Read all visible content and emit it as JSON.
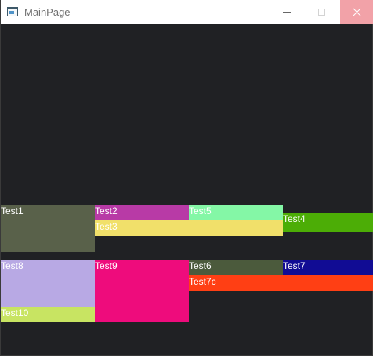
{
  "window": {
    "title": "MainPage",
    "controls": {
      "minimize": "minimize",
      "maximize": "maximize",
      "close": "close"
    }
  },
  "tiles": [
    {
      "id": "t1",
      "label": "Test1",
      "color": "#59614a"
    },
    {
      "id": "t2",
      "label": "Test2",
      "color": "#b83aa6"
    },
    {
      "id": "t3",
      "label": "Test3",
      "color": "#f1e06a"
    },
    {
      "id": "t4",
      "label": "Test4",
      "color": "#4cad06"
    },
    {
      "id": "t5",
      "label": "Test5",
      "color": "#84f7a6"
    },
    {
      "id": "t6",
      "label": "Test6",
      "color": "#4b5a3c"
    },
    {
      "id": "t7",
      "label": "Test7",
      "color": "#110c94"
    },
    {
      "id": "t7c",
      "label": "Test7c",
      "color": "#ff3f14"
    },
    {
      "id": "t8",
      "label": "Test8",
      "color": "#b8a9e4"
    },
    {
      "id": "t9",
      "label": "Test9",
      "color": "#ee0c7c"
    },
    {
      "id": "t10",
      "label": "Test10",
      "color": "#c8e462"
    }
  ],
  "colors": {
    "background": "#202124",
    "titlebar": "#ffffff",
    "close_hover": "#f2a2a8",
    "tile_text": "#ffffff"
  }
}
